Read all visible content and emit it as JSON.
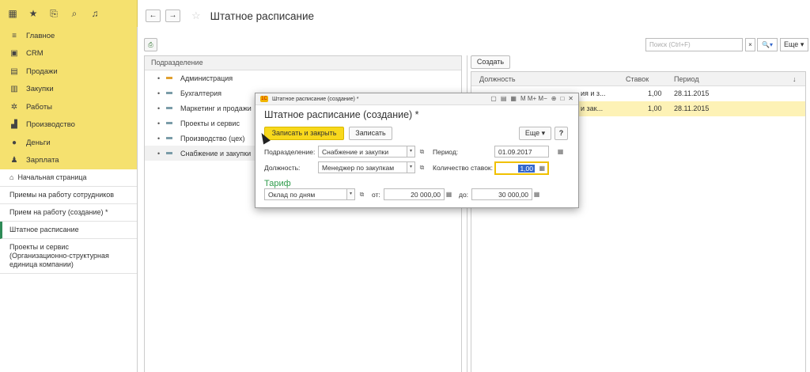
{
  "topbar": {
    "icons": [
      "grid-menu-icon",
      "star-icon",
      "history-icon",
      "search-icon",
      "bell-icon"
    ]
  },
  "sidebar": {
    "sections": [
      {
        "label": "Главное",
        "icon": "menu-icon"
      },
      {
        "label": "CRM",
        "icon": "crm-icon"
      },
      {
        "label": "Продажи",
        "icon": "sales-icon"
      },
      {
        "label": "Закупки",
        "icon": "purchases-icon"
      },
      {
        "label": "Работы",
        "icon": "works-icon"
      },
      {
        "label": "Производство",
        "icon": "production-icon"
      },
      {
        "label": "Деньги",
        "icon": "money-icon"
      },
      {
        "label": "Зарплата",
        "icon": "salary-icon"
      }
    ],
    "open_items": [
      {
        "label": "Начальная страница",
        "icon": "home-icon"
      },
      {
        "label": "Приемы на работу сотрудников"
      },
      {
        "label": "Прием на работу (создание) *"
      },
      {
        "label": "Штатное расписание"
      },
      {
        "label": "Проекты и сервис (Организационно-структурная единица компании)"
      }
    ]
  },
  "header": {
    "back": "←",
    "forward": "→",
    "star": "☆",
    "title": "Штатное расписание"
  },
  "toolbar": {
    "search_placeholder": "Поиск (Ctrl+F)",
    "clear": "×",
    "find": "🔍▾",
    "more": "Еще ▾"
  },
  "tree": {
    "header": "Подразделение",
    "rows": [
      {
        "label": "Администрация"
      },
      {
        "label": "Бухгалтерия"
      },
      {
        "label": "Маркетинг и продажи"
      },
      {
        "label": "Проекты и сервис"
      },
      {
        "label": "Производство (цех)"
      },
      {
        "label": "Снабжение и закупки"
      }
    ]
  },
  "list": {
    "create_label": "Создать",
    "columns": {
      "position": "Должность",
      "rate": "Ставок",
      "period": "Период",
      "sort": "↓"
    },
    "rows": [
      {
        "position": "ия и з...",
        "rate": "1,00",
        "period": "28.11.2015"
      },
      {
        "position": "и зак...",
        "rate": "1,00",
        "period": "28.11.2015"
      }
    ]
  },
  "modal": {
    "window_title": "Штатное расписание (создание) *",
    "tools": "M  M+  M−",
    "heading": "Штатное расписание (создание) *",
    "save_close": "Записать и закрыть",
    "save": "Записать",
    "more": "Еще ▾",
    "help": "?",
    "division_label": "Подразделение:",
    "division_value": "Снабжение и закупки",
    "period_label": "Период:",
    "period_value": "01.09.2017",
    "position_label": "Должность:",
    "position_value": "Менеджер по закупкам",
    "rates_label": "Количество ставок:",
    "rates_value": "1,00",
    "tariff_label": "Тариф",
    "tariff_value": "Оклад по дням",
    "from_label": "от:",
    "from_value": "20 000,00",
    "to_label": "до:",
    "to_value": "30 000,00"
  }
}
